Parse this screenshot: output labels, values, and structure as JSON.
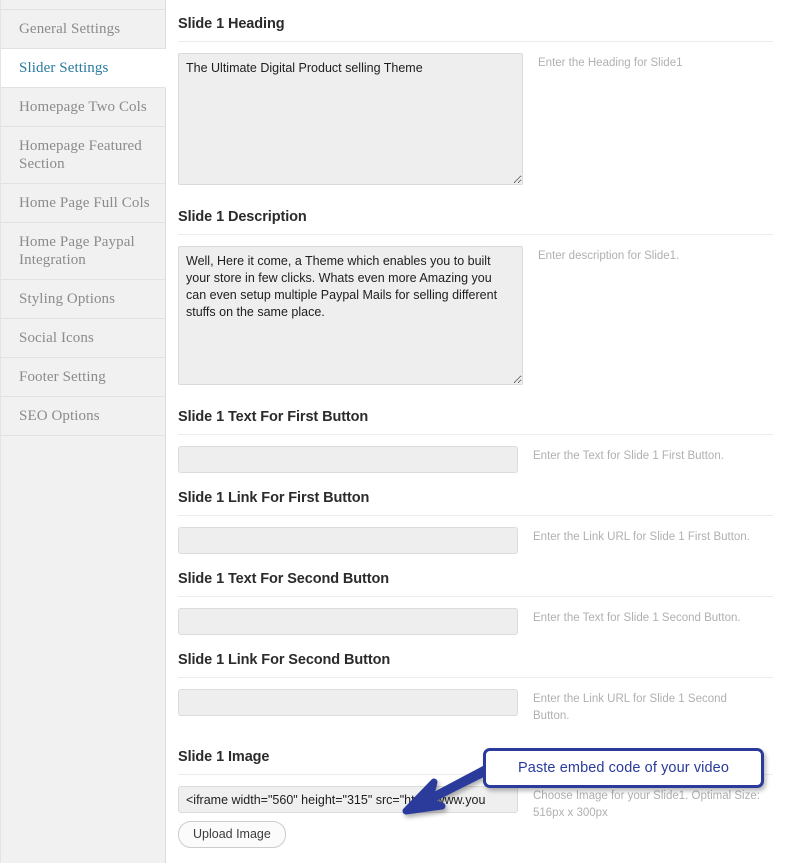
{
  "sidebar": {
    "items": [
      {
        "label": "General Settings",
        "active": false
      },
      {
        "label": "Slider Settings",
        "active": true
      },
      {
        "label": "Homepage Two Cols",
        "active": false
      },
      {
        "label": "Homepage Featured Section",
        "active": false
      },
      {
        "label": "Home Page Full Cols",
        "active": false
      },
      {
        "label": "Home Page Paypal Integration",
        "active": false
      },
      {
        "label": "Styling Options",
        "active": false
      },
      {
        "label": "Social Icons",
        "active": false
      },
      {
        "label": "Footer Setting",
        "active": false
      },
      {
        "label": "SEO Options",
        "active": false
      }
    ]
  },
  "fields": {
    "heading": {
      "title": "Slide 1 Heading",
      "value": "The Ultimate Digital Product selling Theme",
      "help": "Enter the Heading for Slide1"
    },
    "description": {
      "title": "Slide 1 Description",
      "value": "Well, Here it come, a Theme which enables you to built your store in few clicks. Whats even more Amazing you can even setup multiple Paypal Mails for selling different stuffs on the same place.",
      "help": "Enter description for Slide1."
    },
    "first_button_text": {
      "title": "Slide 1 Text For First Button",
      "value": "",
      "help": "Enter the Text for Slide 1 First Button."
    },
    "first_button_link": {
      "title": "Slide 1 Link For First Button",
      "value": "",
      "help": "Enter the Link URL for Slide 1 First Button."
    },
    "second_button_text": {
      "title": "Slide 1 Text For Second Button",
      "value": "",
      "help": "Enter the Text for Slide 1 Second Button."
    },
    "second_button_link": {
      "title": "Slide 1 Link For Second Button",
      "value": "",
      "help": "Enter the Link URL for Slide 1 Second Button."
    },
    "image": {
      "title": "Slide 1 Image",
      "value": "<iframe width=\"560\" height=\"315\" src=\"http://www.you",
      "help": "Choose Image for your Slide1. Optimal Size: 516px x 300px",
      "upload_label": "Upload Image"
    }
  },
  "annotation": {
    "callout_text": "Paste embed code of your video",
    "border_color": "#2a3b9b",
    "text_color": "#2a3b9b",
    "arrow_color": "#2a3b9b"
  },
  "colors": {
    "sidebar_bg": "#f1f1f1",
    "active_link": "#2a7aa0",
    "field_bg": "#eeeeee",
    "help_text": "#b0b0b0",
    "title_text": "#2b2b2b"
  }
}
